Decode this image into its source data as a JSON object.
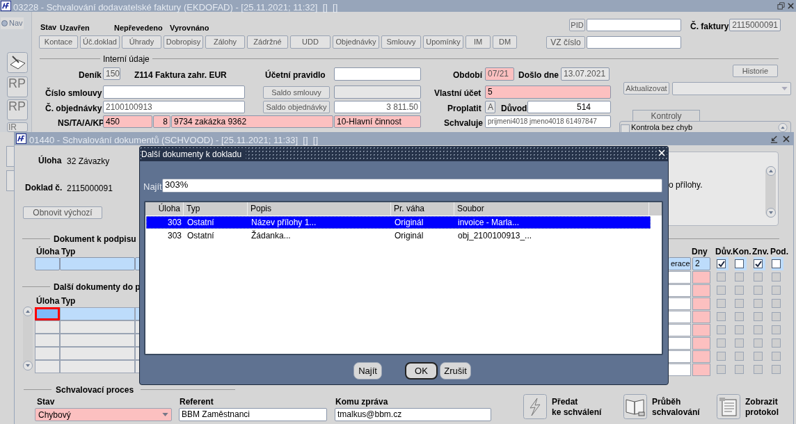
{
  "back_window": {
    "title": "03228 - Schvalování dodavatelské faktury (EKDOFAD) - [25.11.2021; 11:32]  []  []",
    "nav": {
      "label": "Nav",
      "selected": false
    },
    "side_tools": [
      "RP",
      "RP",
      "IR"
    ],
    "status": {
      "label": "Stav",
      "values": [
        "Uzavřen",
        "Nepřevedeno",
        "Vyrovnáno"
      ]
    },
    "buttons": [
      "Kontace",
      "Úč.doklad",
      "Úhrady",
      "Dobropisy",
      "Zálohy",
      "Zádržné",
      "UDD",
      "Objednávky",
      "Smlouvy",
      "Upomínky",
      "IM",
      "DM"
    ],
    "pid_button": "PID",
    "vz_button": "VZ číslo",
    "invoice": {
      "label": "Č. faktury",
      "value": "2115000091"
    },
    "section": "Interní údaje",
    "journal": {
      "label": "Deník",
      "code": "150",
      "name": "Z114 Faktura zahr. EUR"
    },
    "accounting_rule": {
      "label": "Účetní pravidlo"
    },
    "contract": {
      "label": "Číslo smlouvy",
      "button": "Saldo smlouvy"
    },
    "order": {
      "label": "Č. objednávky",
      "value": "2100100913",
      "button": "Saldo objednávky",
      "balance": "3 811.50"
    },
    "ns": {
      "label": "NS/TA/A/KP",
      "values": [
        "450",
        "8",
        "9734 zakázka 9362",
        "10-Hlavní činnost"
      ]
    },
    "period": {
      "label": "Období",
      "value": "07/21"
    },
    "received": {
      "label": "Došlo dne",
      "value": "13.07.2021"
    },
    "own_account": {
      "label": "Vlastní účet",
      "value": "5"
    },
    "pay": {
      "label": "Proplatit",
      "value": "A"
    },
    "reason": {
      "label": "Důvod",
      "value": "514"
    },
    "approver": {
      "label": "Schvaluje",
      "value": "prijmeni4018 jmeno4018 61497847"
    },
    "history_button": "Historie",
    "update_button": "Aktualizovat",
    "checks_tab": "Kontroly",
    "check_item": {
      "label": "Kontrola bez chyb",
      "checked": false
    }
  },
  "front_window": {
    "title": "01440 - Schvalování dokumentů (SCHVOOD) - [25.11.2021; 11:33]  []  []",
    "task": {
      "label": "Úloha",
      "value": "32 Závazky"
    },
    "doc": {
      "label": "Doklad č.",
      "value": "2115000091"
    },
    "reset_button": "Obnovit výchozí",
    "message": "o přílohy.",
    "sign_section": {
      "title": "Dokument k podpisu",
      "columns": [
        "Úloha",
        "Typ"
      ]
    },
    "more_section": {
      "title": "Další dokumenty do p",
      "columns": [
        "Úloha",
        "Typ"
      ],
      "rows": [
        {
          "selected": true
        },
        {
          "selected": false
        },
        {
          "selected": false
        },
        {
          "selected": false
        },
        {
          "selected": false
        }
      ]
    },
    "right_table": {
      "columns": [
        "Dny",
        "Dův.",
        "Kon.",
        "Znv.",
        "Pod."
      ],
      "first_row": {
        "text": "erace",
        "days": "2",
        "flags": [
          true,
          false,
          true,
          false
        ]
      },
      "rows": [
        {
          "flags": [
            false,
            false,
            false,
            false
          ]
        },
        {
          "flags": [
            false,
            false,
            false,
            false
          ]
        },
        {
          "flags": [
            false,
            false,
            false,
            false
          ]
        },
        {
          "flags": [
            false,
            false,
            false,
            false
          ]
        },
        {
          "flags": [
            false,
            false,
            false,
            false
          ]
        },
        {
          "flags": [
            false,
            false,
            false,
            false
          ]
        },
        {
          "flags": [
            false,
            false,
            false,
            false
          ]
        },
        {
          "flags": [
            false,
            false,
            false,
            false
          ]
        }
      ]
    },
    "process": {
      "title": "Schvalovací proces",
      "state": {
        "label": "Stav",
        "value": "Chybový"
      },
      "referent": {
        "label": "Referent",
        "value": "BBM Zaměstnanci"
      },
      "recipient": {
        "label": "Komu zpráva",
        "value": "tmalkus@bbm.cz"
      }
    },
    "actions": [
      {
        "kind": "send",
        "lines": [
          "Předat",
          "ke schválení"
        ]
      },
      {
        "kind": "progress",
        "lines": [
          "Průběh",
          "schvalování"
        ]
      },
      {
        "kind": "protocol",
        "lines": [
          "Zobrazit",
          "protokol"
        ]
      }
    ]
  },
  "dialog": {
    "title": "Další dokumenty k dokladu",
    "search": {
      "label": "Najít",
      "value": "303%"
    },
    "columns": [
      "Úloha",
      "Typ",
      "Popis",
      "Pr. váha",
      "Soubor"
    ],
    "rows": [
      {
        "cells": [
          "303",
          "Ostatní",
          "Název přílohy 1...",
          "Originál",
          "invoice - Marla..."
        ],
        "selected": true
      },
      {
        "cells": [
          "303",
          "Ostatní",
          "Žádanka...",
          "Originál",
          "obj_2100100913_..."
        ],
        "selected": false
      }
    ],
    "buttons": [
      "Najít",
      "OK",
      "Zrušit"
    ]
  }
}
